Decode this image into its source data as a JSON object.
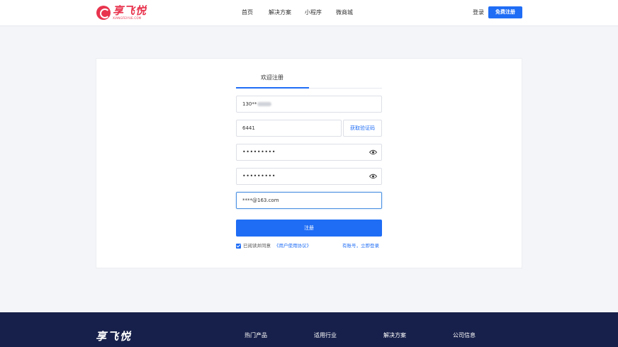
{
  "header": {
    "logo_text": "享飞悦",
    "logo_sub": "XIANGFEIYUE.COM",
    "nav": [
      "首页",
      "解决方案",
      "小程序",
      "微商城"
    ],
    "login_label": "登录",
    "signup_label": "免费注册"
  },
  "form": {
    "tab_title": "欢迎注册",
    "phone_value": "130**",
    "code_value": "6441",
    "code_button": "获取验证码",
    "password_value": "•••••••••",
    "confirm_value": "•••••••••",
    "email_value": "****@163.com",
    "submit_label": "注册",
    "agree_text": "已阅读并同意",
    "agree_link": "《用户使用协议》",
    "have_account": "有账号，立即登录",
    "agree_checked": true
  },
  "footer": {
    "logo_text": "享飞悦",
    "columns": [
      "热门产品",
      "适用行业",
      "解决方案",
      "公司信息"
    ]
  },
  "colors": {
    "accent": "#1f6df5",
    "brand": "#e8344e",
    "footer_bg": "#17204a"
  }
}
